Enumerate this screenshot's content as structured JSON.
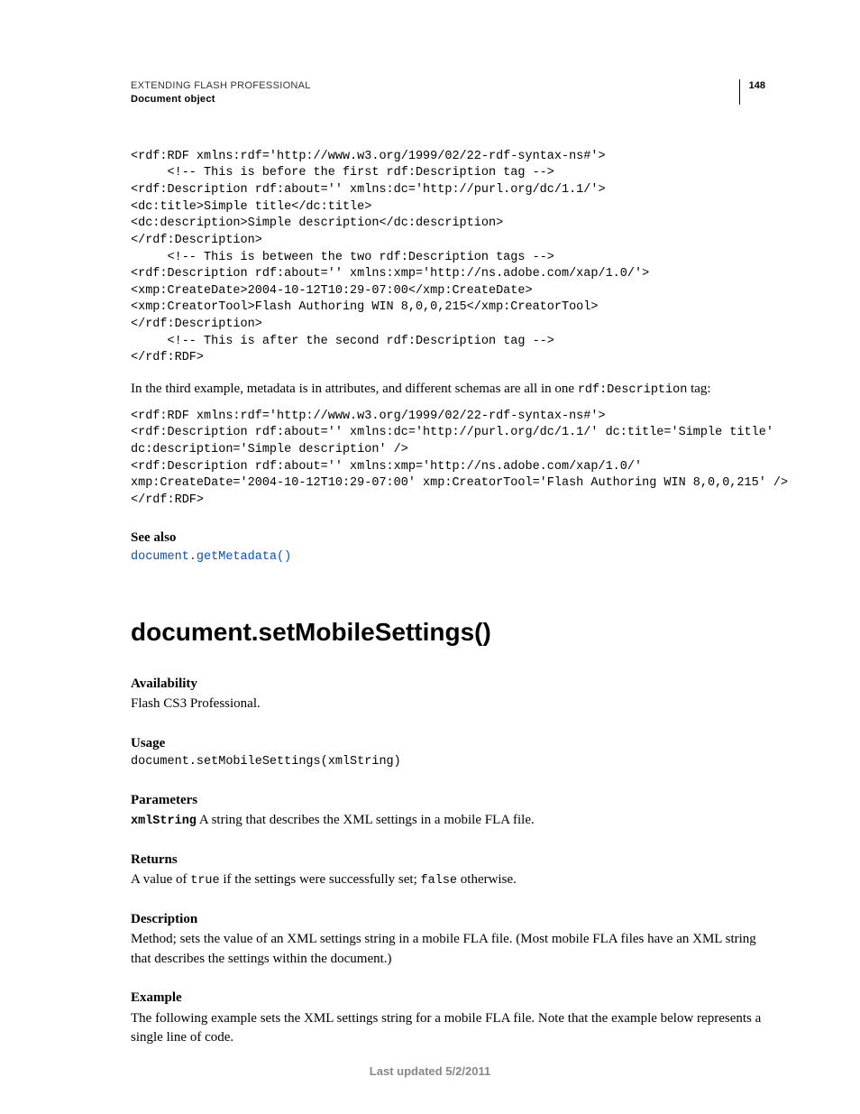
{
  "header": {
    "title": "EXTENDING FLASH PROFESSIONAL",
    "subtitle": "Document object",
    "page": "148"
  },
  "code1": "<rdf:RDF xmlns:rdf='http://www.w3.org/1999/02/22-rdf-syntax-ns#'> \n     <!-- This is before the first rdf:Description tag --> \n<rdf:Description rdf:about='' xmlns:dc='http://purl.org/dc/1.1/'> \n<dc:title>Simple title</dc:title> \n<dc:description>Simple description</dc:description> \n</rdf:Description> \n     <!-- This is between the two rdf:Description tags --> \n<rdf:Description rdf:about='' xmlns:xmp='http://ns.adobe.com/xap/1.0/'> \n<xmp:CreateDate>2004-10-12T10:29-07:00</xmp:CreateDate> \n<xmp:CreatorTool>Flash Authoring WIN 8,0,0,215</xmp:CreatorTool> \n</rdf:Description> \n     <!-- This is after the second rdf:Description tag --> \n</rdf:RDF>",
  "para1_a": "In the third example, metadata is in attributes, and different schemas are all in one ",
  "para1_code": "rdf:Description",
  "para1_b": " tag:",
  "code2": "<rdf:RDF xmlns:rdf='http://www.w3.org/1999/02/22-rdf-syntax-ns#'> \n<rdf:Description rdf:about='' xmlns:dc='http://purl.org/dc/1.1/' dc:title='Simple title' \ndc:description='Simple description' /> \n<rdf:Description rdf:about='' xmlns:xmp='http://ns.adobe.com/xap/1.0/' \nxmp:CreateDate='2004-10-12T10:29-07:00' xmp:CreatorTool='Flash Authoring WIN 8,0,0,215' /> \n</rdf:RDF>",
  "see_also_label": "See also",
  "see_also_link": "document.getMetadata()",
  "method_title": "document.setMobileSettings()",
  "availability": {
    "label": "Availability",
    "text": "Flash CS3 Professional."
  },
  "usage": {
    "label": "Usage",
    "code": "document.setMobileSettings(xmlString)"
  },
  "parameters": {
    "label": "Parameters",
    "name": "xmlString",
    "text": "  A string that describes the XML settings in a mobile FLA file."
  },
  "returns": {
    "label": "Returns",
    "a": "A value of ",
    "c1": "true",
    "b": " if the settings were successfully set; ",
    "c2": "false",
    "c": " otherwise."
  },
  "description": {
    "label": "Description",
    "text": "Method; sets the value of an XML settings string in a mobile FLA file. (Most mobile FLA files have an XML string that describes the settings within the document.)"
  },
  "example": {
    "label": "Example",
    "text": "The following example sets the XML settings string for a mobile FLA file. Note that the example below represents a single line of code."
  },
  "footer": "Last updated 5/2/2011"
}
